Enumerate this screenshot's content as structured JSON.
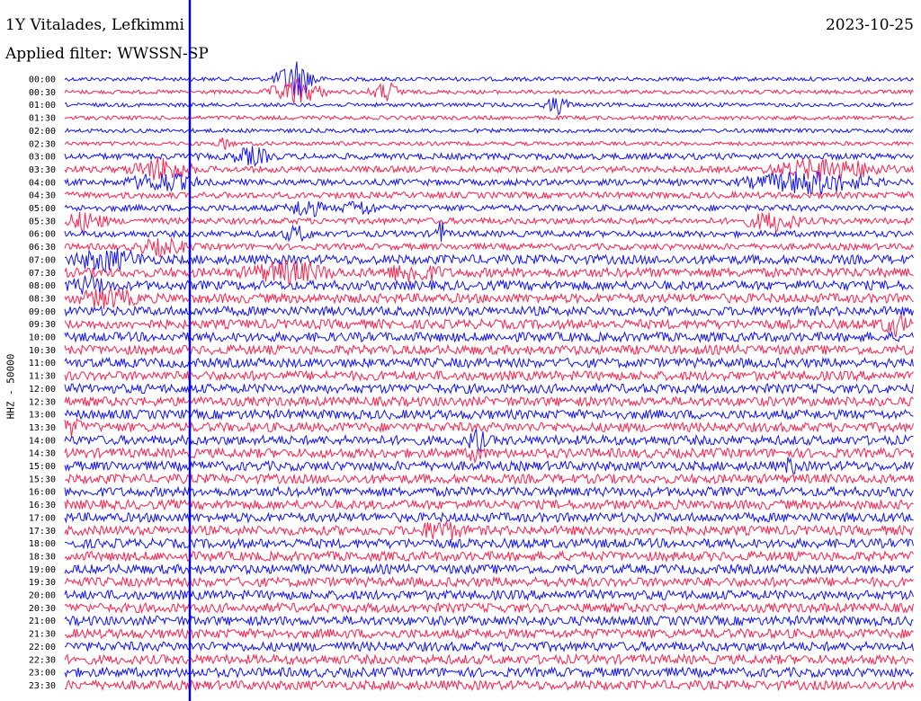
{
  "header": {
    "title": "1Y Vitalades, Lefkimmi",
    "date": "2023-10-25",
    "filter": "Applied filter: WWSSN-SP"
  },
  "colors": {
    "trace_a": "#1010ff",
    "trace_b": "#ff1f4b",
    "marker": "#0000dd",
    "background": "#ffffff"
  },
  "chart_data": {
    "type": "line",
    "title": "1Y Vitalades, Lefkimmi",
    "ylabel": "HHZ - 50000",
    "xlabel": "",
    "series_colors_alternate": [
      "#1010ff",
      "#ff1f4b"
    ],
    "time_ticks": [
      "00:00",
      "00:30",
      "01:00",
      "01:30",
      "02:00",
      "02:30",
      "03:00",
      "03:30",
      "04:00",
      "04:30",
      "05:00",
      "05:30",
      "06:00",
      "06:30",
      "07:00",
      "07:30",
      "08:00",
      "08:30",
      "09:00",
      "09:30",
      "10:00",
      "10:30",
      "11:00",
      "11:30",
      "12:00",
      "12:30",
      "13:00",
      "13:30",
      "14:00",
      "14:30",
      "15:00",
      "15:30",
      "16:00",
      "16:30",
      "17:00",
      "17:30",
      "18:00",
      "18:30",
      "19:00",
      "19:30",
      "20:00",
      "20:30",
      "21:00",
      "21:30",
      "22:00",
      "22:30",
      "23:00",
      "23:30"
    ],
    "grid": false,
    "legend": "none"
  }
}
